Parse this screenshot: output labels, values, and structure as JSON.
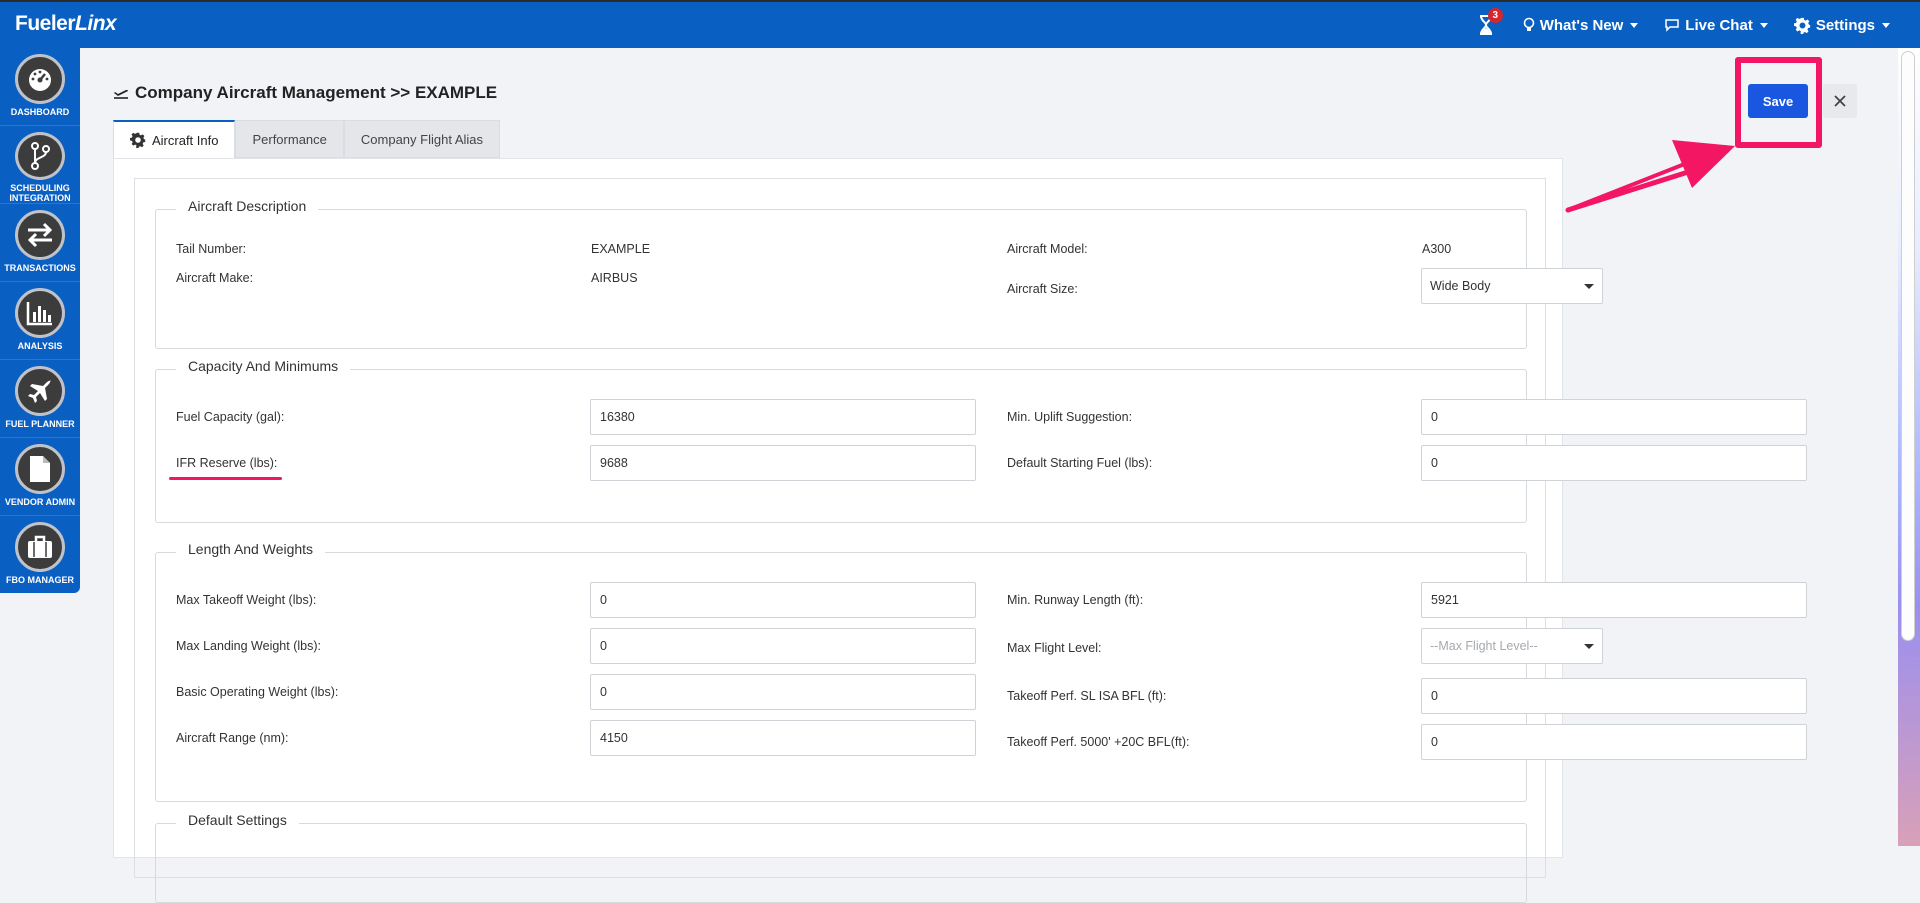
{
  "app": {
    "logo_main": "Fueler",
    "logo_italic": "Linx",
    "notification_count": "3",
    "nav": {
      "whats_new": "What's New",
      "live_chat": "Live Chat",
      "settings": "Settings"
    }
  },
  "sidebar": {
    "items": [
      {
        "label": "DASHBOARD",
        "icon": "dashboard-gauge-icon"
      },
      {
        "label": "SCHEDULING INTEGRATION",
        "icon": "branch-icon"
      },
      {
        "label": "TRANSACTIONS",
        "icon": "swap-arrows-icon"
      },
      {
        "label": "ANALYSIS",
        "icon": "bar-chart-icon"
      },
      {
        "label": "FUEL PLANNER",
        "icon": "airplane-icon"
      },
      {
        "label": "VENDOR ADMIN",
        "icon": "document-icon"
      },
      {
        "label": "FBO MANAGER",
        "icon": "briefcase-icon"
      }
    ]
  },
  "page": {
    "title": "Company Aircraft Management >> EXAMPLE",
    "save_label": "Save",
    "tabs": [
      {
        "label": "Aircraft Info",
        "active": true
      },
      {
        "label": "Performance",
        "active": false
      },
      {
        "label": "Company Flight Alias",
        "active": false
      }
    ]
  },
  "aircraft_description": {
    "title": "Aircraft Description",
    "tail_number_label": "Tail Number:",
    "tail_number": "EXAMPLE",
    "aircraft_model_label": "Aircraft Model:",
    "aircraft_model": "A300",
    "aircraft_make_label": "Aircraft Make:",
    "aircraft_make": "AIRBUS",
    "aircraft_size_label": "Aircraft Size:",
    "aircraft_size": "Wide Body"
  },
  "capacity": {
    "title": "Capacity And Minimums",
    "fuel_capacity_label": "Fuel Capacity (gal):",
    "fuel_capacity": "16380",
    "min_uplift_label": "Min. Uplift Suggestion:",
    "min_uplift": "0",
    "ifr_reserve_label": "IFR Reserve (lbs):",
    "ifr_reserve": "9688",
    "default_start_fuel_label": "Default Starting Fuel (lbs):",
    "default_start_fuel": "0"
  },
  "weights": {
    "title": "Length And Weights",
    "max_takeoff_label": "Max Takeoff Weight (lbs):",
    "max_takeoff": "0",
    "min_runway_label": "Min. Runway Length (ft):",
    "min_runway": "5921",
    "max_landing_label": "Max Landing Weight (lbs):",
    "max_landing": "0",
    "max_flight_level_label": "Max Flight Level:",
    "max_flight_level_placeholder": "--Max Flight Level--",
    "basic_operating_label": "Basic Operating Weight (lbs):",
    "basic_operating": "0",
    "takeoff_sl_label": "Takeoff Perf. SL ISA BFL (ft):",
    "takeoff_sl": "0",
    "range_label": "Aircraft Range (nm):",
    "range": "4150",
    "takeoff_5000_label": "Takeoff Perf. 5000' +20C BFL(ft):",
    "takeoff_5000": "0"
  },
  "default_settings": {
    "title": "Default Settings"
  },
  "colors": {
    "brand_blue": "#0a5fc2",
    "save_blue": "#1a57e0",
    "annotation_pink": "#f21663"
  }
}
